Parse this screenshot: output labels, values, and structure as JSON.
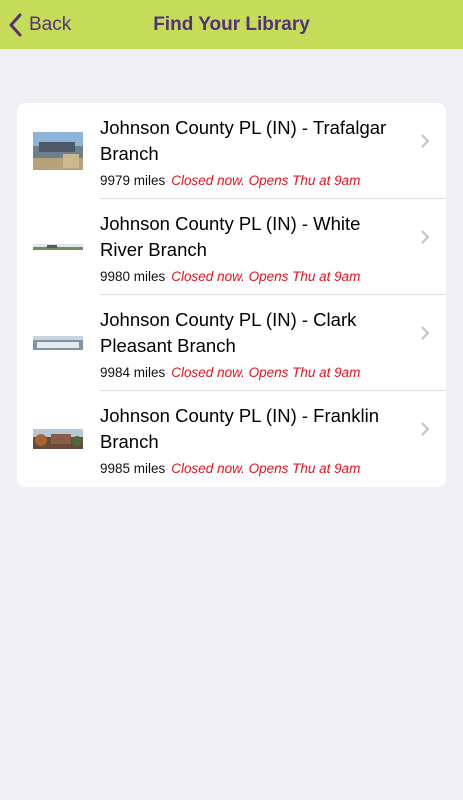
{
  "nav": {
    "back_label": "Back",
    "title": "Find Your Library"
  },
  "branches": [
    {
      "name": "Johnson County PL (IN) - Trafalgar Branch",
      "distance": "9979 miles",
      "status": "Closed now. Opens Thu at 9am"
    },
    {
      "name": "Johnson County PL (IN) - White River Branch",
      "distance": "9980 miles",
      "status": "Closed now. Opens Thu at 9am"
    },
    {
      "name": "Johnson County PL (IN) - Clark Pleasant Branch",
      "distance": "9984 miles",
      "status": "Closed now. Opens Thu at 9am"
    },
    {
      "name": "Johnson County PL (IN) - Franklin Branch",
      "distance": "9985 miles",
      "status": "Closed now. Opens Thu at 9am"
    }
  ],
  "colors": {
    "navbar": "#c5dc58",
    "nav_text": "#55307a",
    "status_closed": "#e0141e"
  }
}
